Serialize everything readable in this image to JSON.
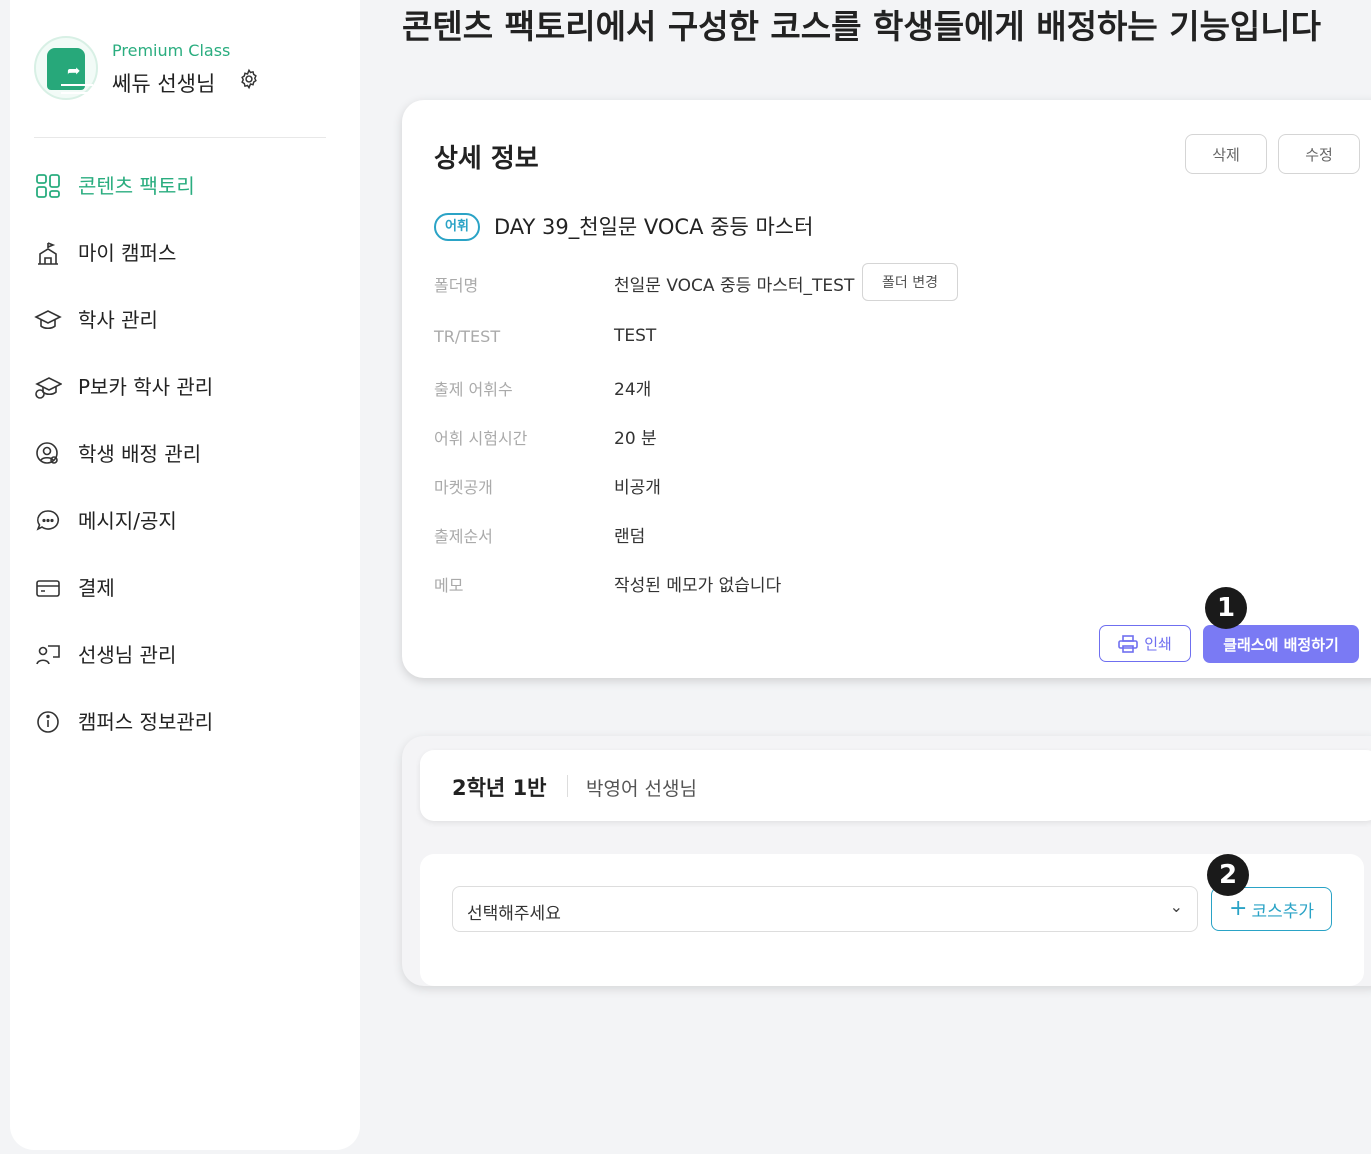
{
  "headline": "콘텐츠 팩토리에서 구성한 코스를 학생들에게 배정하는 기능입니다",
  "profile": {
    "tier": "Premium Class",
    "name": "쎄듀 선생님"
  },
  "sidebar": {
    "items": [
      {
        "label": "콘텐츠 팩토리",
        "icon": "grid-icon",
        "active": true
      },
      {
        "label": "마이 캠퍼스",
        "icon": "campus-icon",
        "active": false
      },
      {
        "label": "학사 관리",
        "icon": "graduation-cap-icon",
        "active": false
      },
      {
        "label": "P보카 학사 관리",
        "icon": "p-graduation-cap-icon",
        "active": false
      },
      {
        "label": "학생 배정 관리",
        "icon": "student-assign-icon",
        "active": false
      },
      {
        "label": "메시지/공지",
        "icon": "chat-bubble-icon",
        "active": false
      },
      {
        "label": "결제",
        "icon": "credit-card-icon",
        "active": false
      },
      {
        "label": "선생님 관리",
        "icon": "teacher-board-icon",
        "active": false
      },
      {
        "label": "캠퍼스 정보관리",
        "icon": "info-icon",
        "active": false
      }
    ]
  },
  "detail": {
    "title": "상세 정보",
    "delete_label": "삭제",
    "edit_label": "수정",
    "tag": "어휘",
    "item_title": "DAY 39_천일문 VOCA 중등 마스터",
    "folder_change_label": "폴더 변경",
    "rows": [
      {
        "label": "폴더명",
        "value": "천일문 VOCA 중등 마스터_TEST"
      },
      {
        "label": "TR/TEST",
        "value": "TEST"
      },
      {
        "label": "출제 어휘수",
        "value": "24개"
      },
      {
        "label": "어휘 시험시간",
        "value": "20 분"
      },
      {
        "label": "마켓공개",
        "value": "비공개"
      },
      {
        "label": "출제순서",
        "value": "랜덤"
      },
      {
        "label": "메모",
        "value": "작성된 메모가 없습니다"
      }
    ],
    "print_label": "인쇄",
    "assign_label": "클래스에 배정하기"
  },
  "class_panel": {
    "class_name": "2학년 1반",
    "teacher": "박영어 선생님",
    "select_placeholder": "선택해주세요",
    "add_label": "코스추가"
  },
  "badges": [
    "1",
    "2"
  ],
  "colors": {
    "accent_green": "#2aad7f",
    "accent_blue": "#2aa3c6",
    "accent_purple": "#7a7af4"
  }
}
